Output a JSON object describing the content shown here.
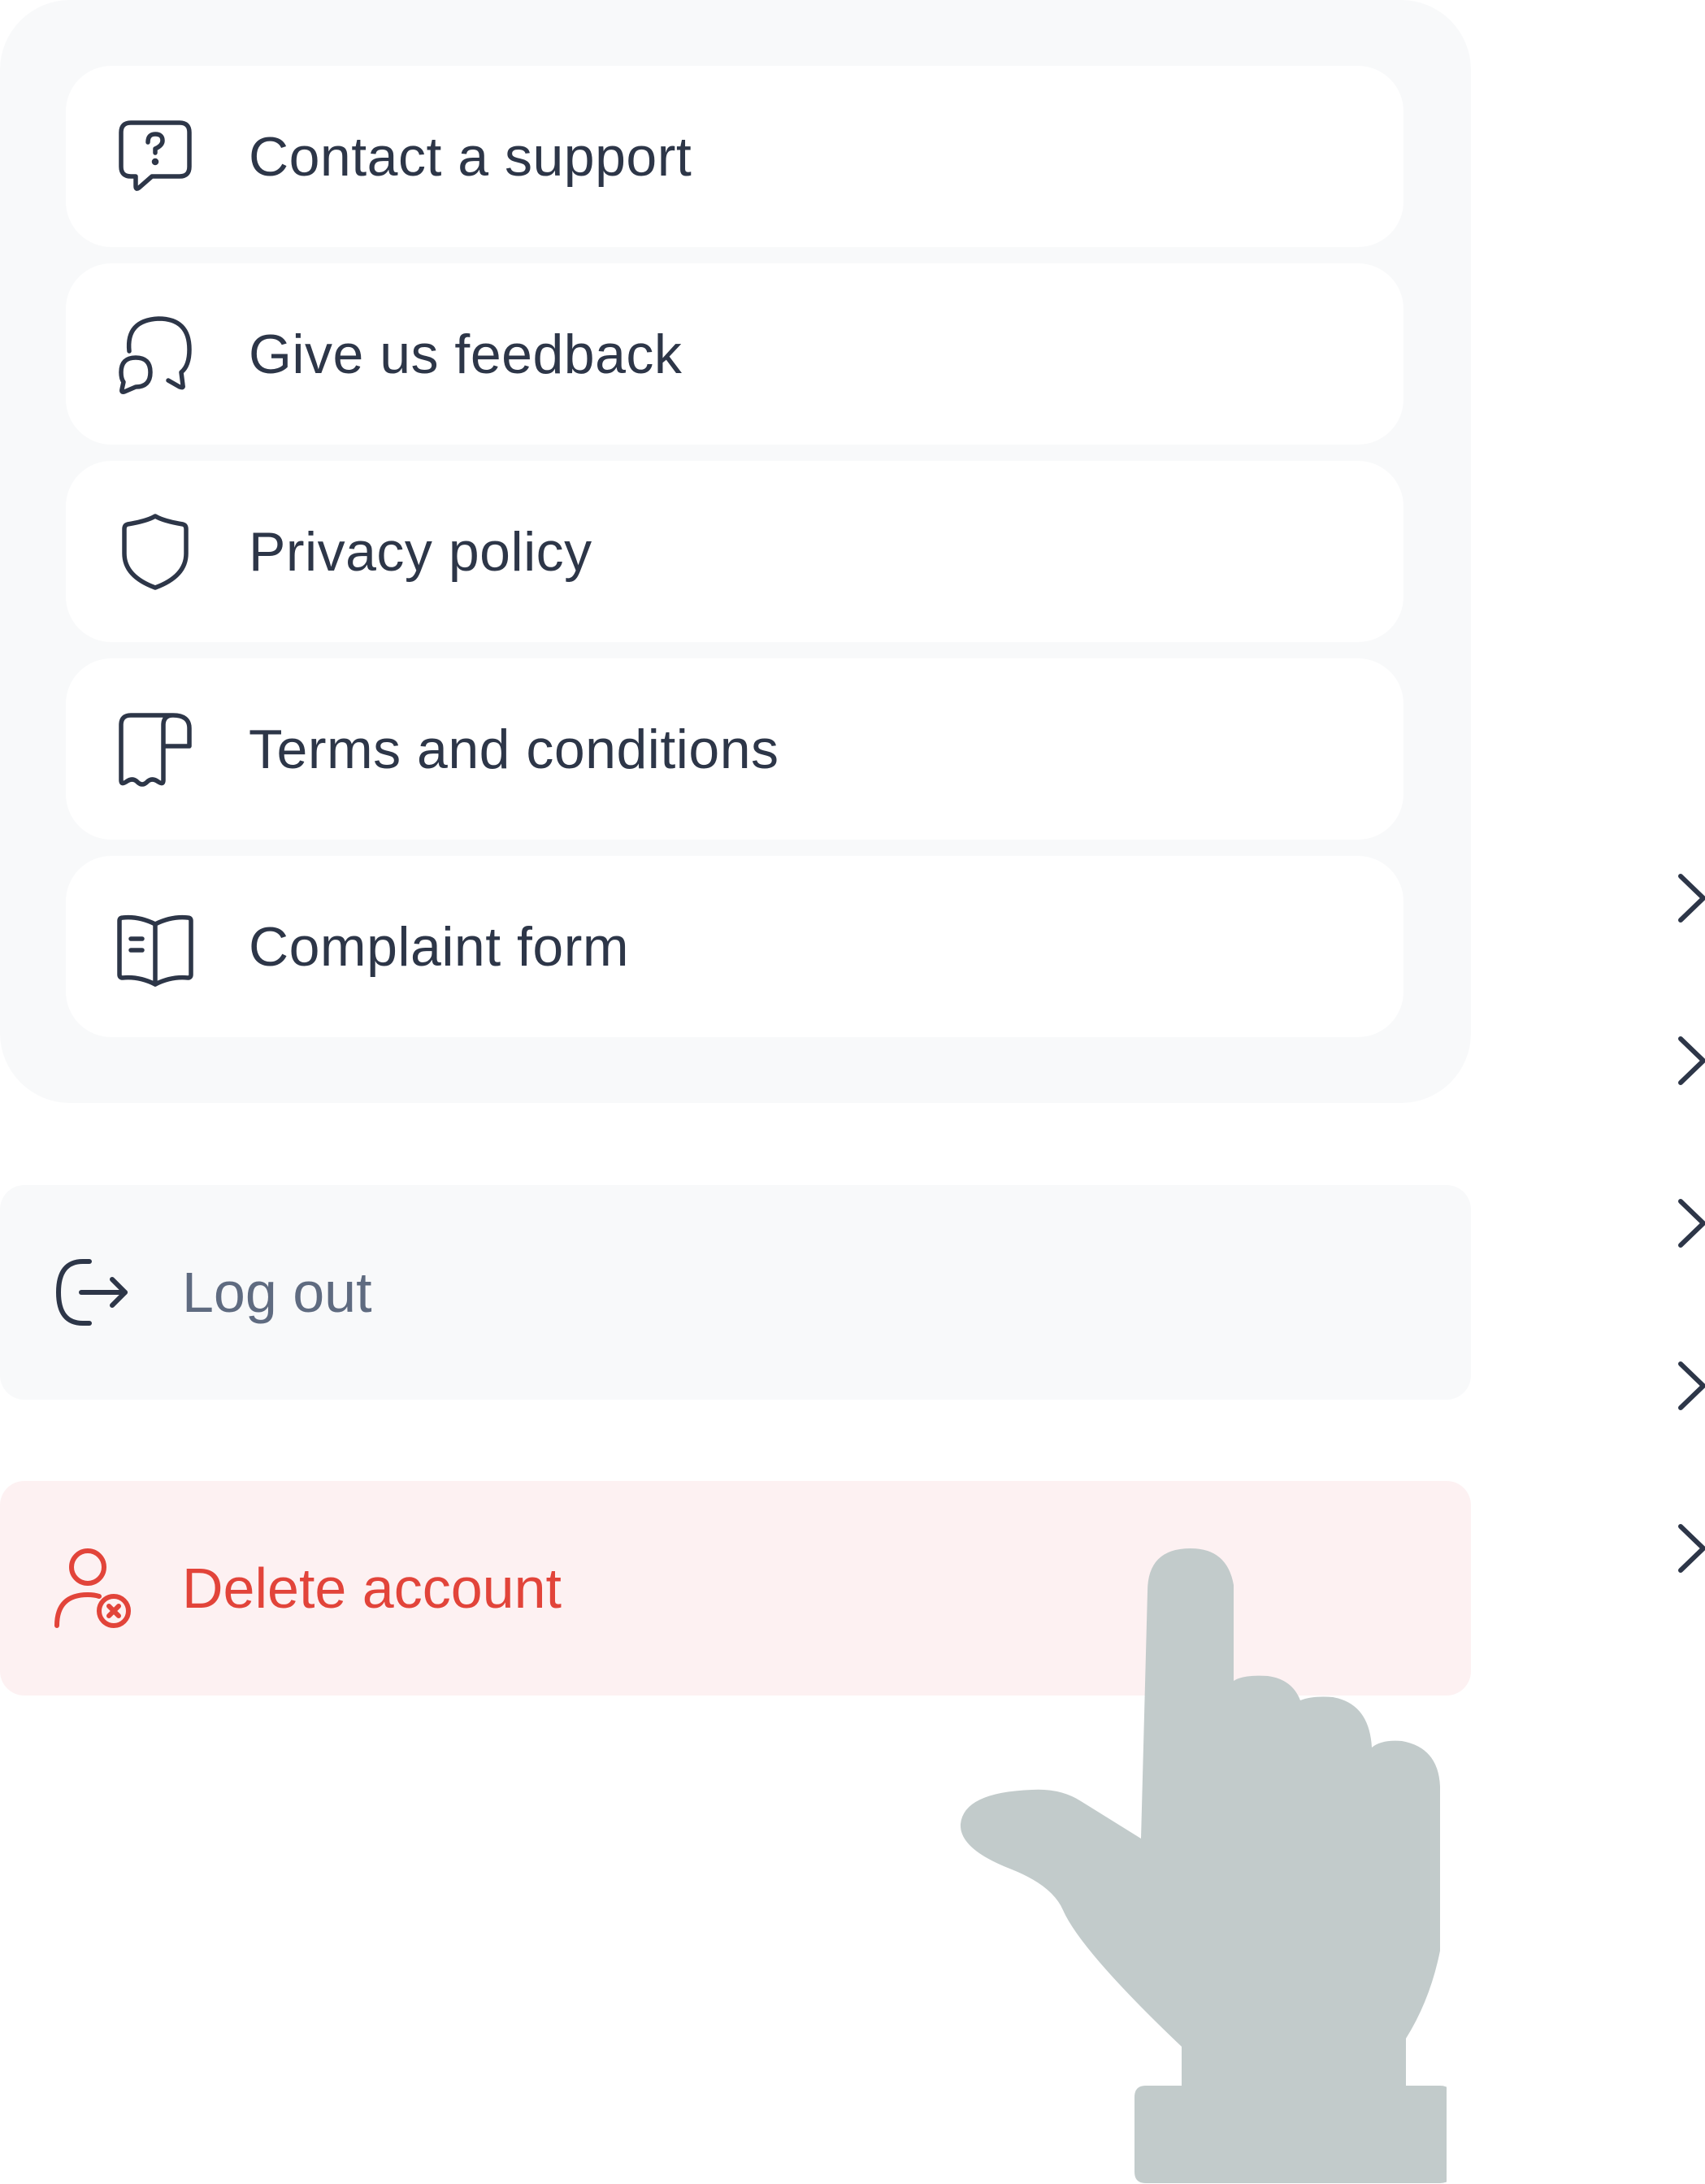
{
  "menu": {
    "items": [
      {
        "label": "Contact a support",
        "icon": "help-chat-icon"
      },
      {
        "label": "Give us feedback",
        "icon": "chat-bubbles-icon"
      },
      {
        "label": "Privacy policy",
        "icon": "shield-icon"
      },
      {
        "label": "Terms and conditions",
        "icon": "receipt-icon"
      },
      {
        "label": "Complaint form",
        "icon": "open-book-icon"
      }
    ]
  },
  "actions": {
    "logout_label": "Log out",
    "delete_label": "Delete account"
  },
  "colors": {
    "text_primary": "#2d3648",
    "text_muted": "#5f6b80",
    "danger": "#e2443a",
    "danger_bg": "#fdf1f2",
    "card_bg": "#f8f9fa",
    "hand": "#c2cbcb"
  }
}
